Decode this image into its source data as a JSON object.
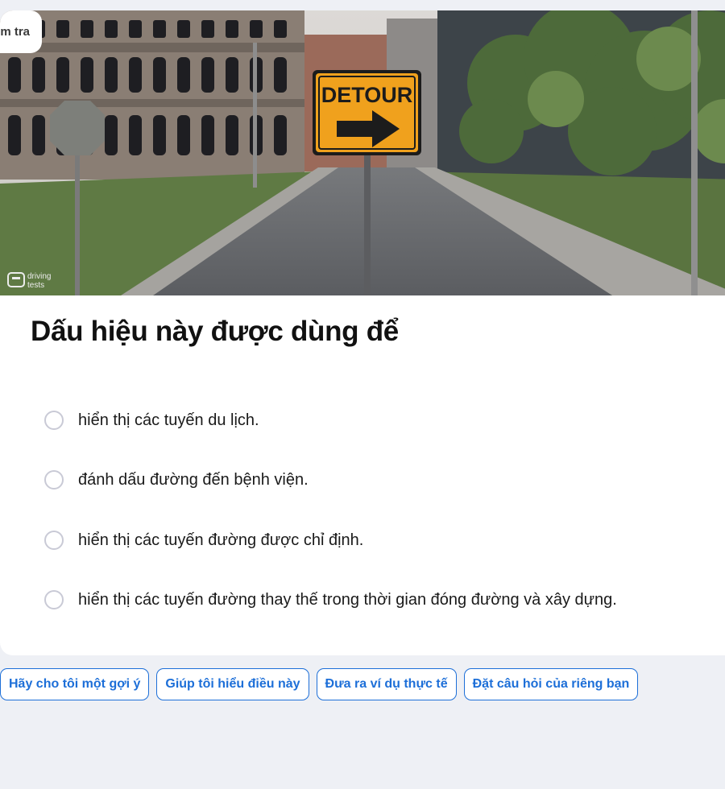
{
  "badge": {
    "label": "m tra"
  },
  "scene": {
    "sign_text": "DETOUR",
    "watermark_line1": "driving",
    "watermark_line2": "tests"
  },
  "question": {
    "title": "Dấu hiệu này được dùng để"
  },
  "options": [
    {
      "label": "hiển thị các tuyến du lịch."
    },
    {
      "label": "đánh dấu đường đến bệnh viện."
    },
    {
      "label": "hiển thị các tuyến đường được chỉ định."
    },
    {
      "label": "hiển thị các tuyến đường thay thế trong thời gian đóng đường và xây dựng."
    }
  ],
  "chips": [
    {
      "label": "Hãy cho tôi một gợi ý"
    },
    {
      "label": "Giúp tôi hiểu điều này"
    },
    {
      "label": "Đưa ra ví dụ thực tế"
    },
    {
      "label": "Đặt câu hỏi của riêng bạn"
    }
  ],
  "colors": {
    "accent": "#1d6fd8",
    "background": "#eef0f5",
    "sign_orange": "#f0a11d"
  }
}
